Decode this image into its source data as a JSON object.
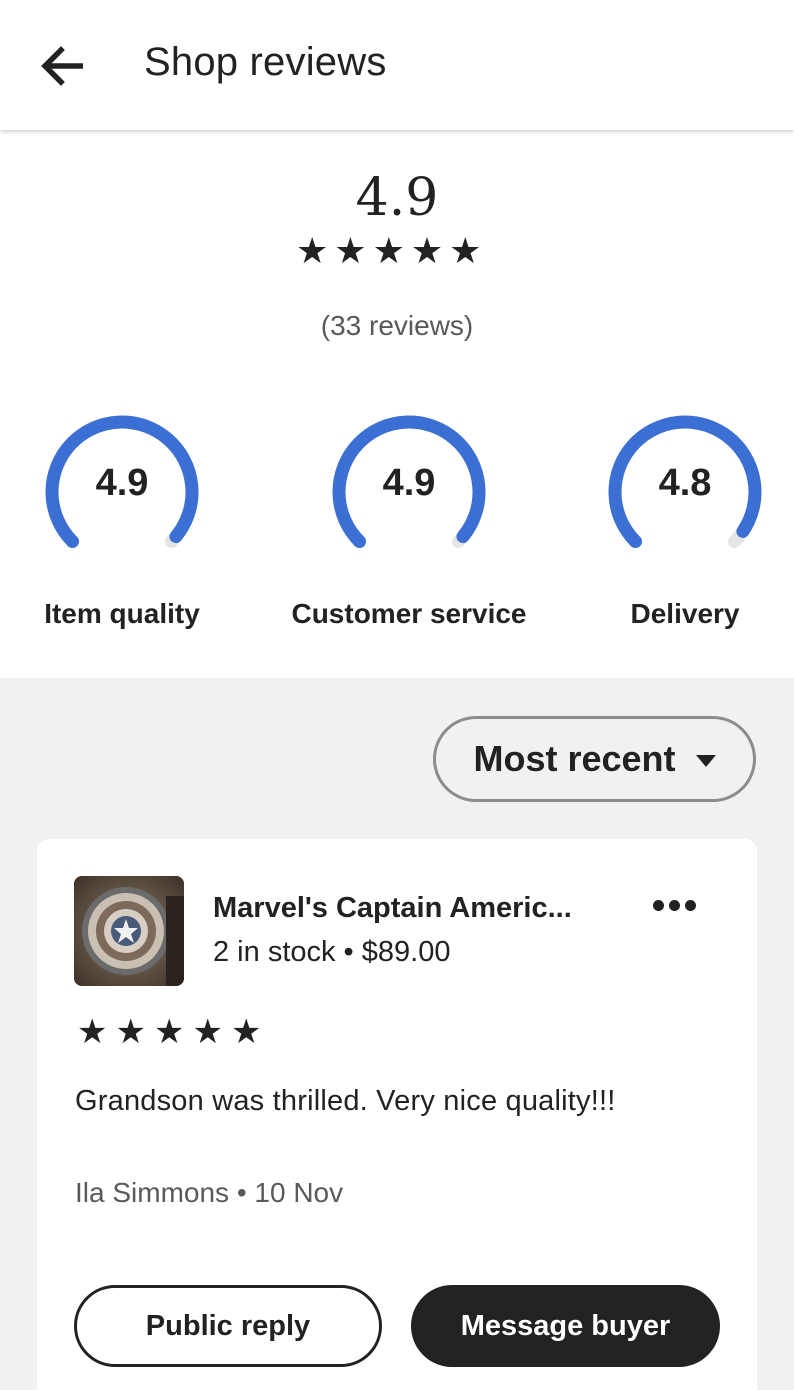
{
  "header": {
    "title": "Shop reviews",
    "back_icon": "arrow-left-icon"
  },
  "summary": {
    "average": "4.9",
    "stars": 5,
    "review_count": "(33 reviews)"
  },
  "metrics": [
    {
      "value": "4.9",
      "label": "Item quality",
      "score": 4.9,
      "max": 5
    },
    {
      "value": "4.9",
      "label": "Customer service",
      "score": 4.9,
      "max": 5
    },
    {
      "value": "4.8",
      "label": "Delivery",
      "score": 4.8,
      "max": 5
    }
  ],
  "sort": {
    "label": "Most recent",
    "icon": "caret-down-icon"
  },
  "review": {
    "item_title": "Marvel's Captain Americ...",
    "item_meta": "2 in stock • $89.00",
    "stars": 5,
    "text": "Grandson was thrilled. Very nice quality!!!",
    "reviewer": "Ila Simmons • 10 Nov",
    "more_icon": "more-horizontal-icon",
    "public_reply_label": "Public reply",
    "message_buyer_label": "Message buyer"
  },
  "colors": {
    "accent": "#3b6fd4",
    "track": "#e5e5e5",
    "text": "#222222",
    "muted": "#595959",
    "background_gray": "#f1f1f1"
  }
}
